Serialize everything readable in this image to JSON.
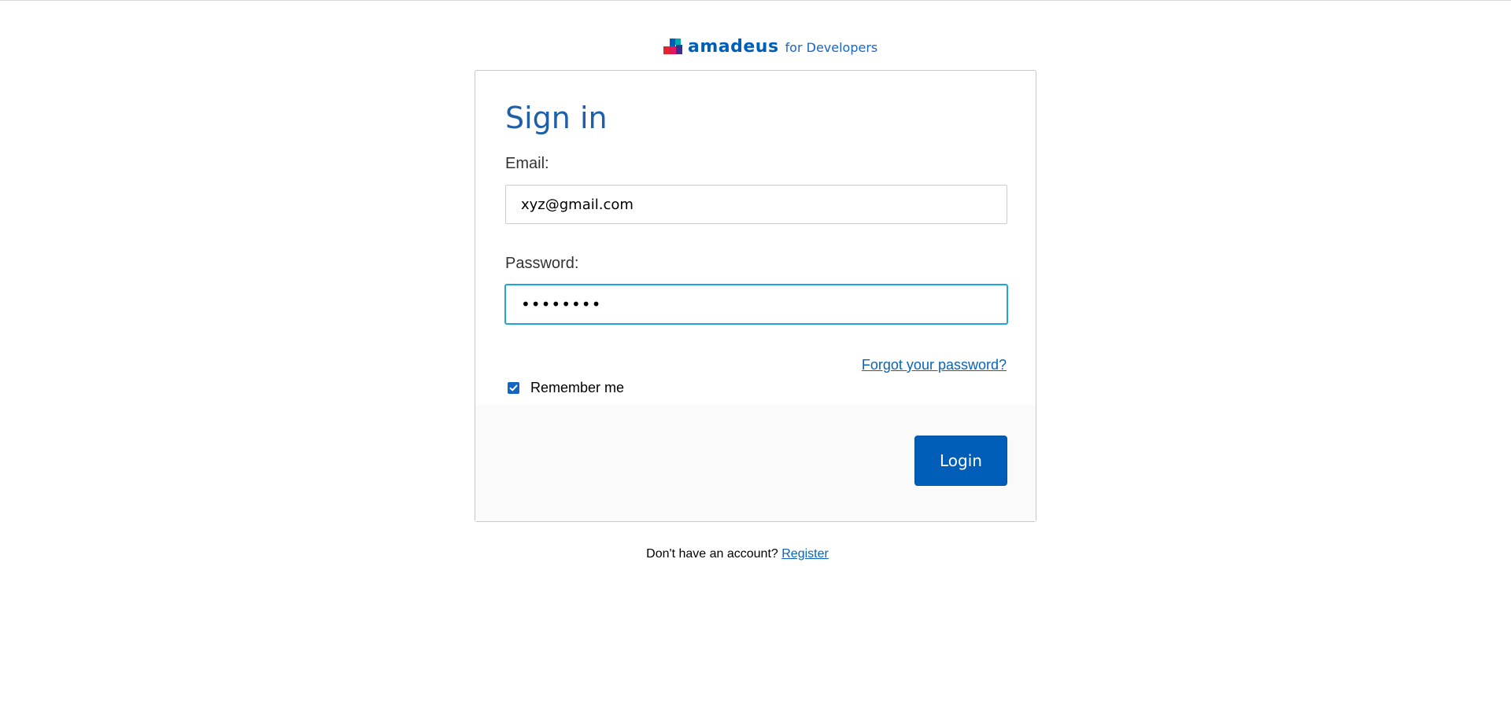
{
  "brand": {
    "name": "amadeus",
    "suffix": "for Developers",
    "color": "#005eb8"
  },
  "form": {
    "title": "Sign in",
    "email_label": "Email:",
    "email_value": "xyz@gmail.com",
    "password_label": "Password:",
    "password_value": "12345678",
    "forgot_link": "Forgot your password?",
    "remember_label": "Remember me",
    "remember_checked": true,
    "login_button": "Login"
  },
  "footer": {
    "prompt": "Don't have an account?",
    "register_link": "Register"
  },
  "icons": {
    "logo": "amadeus-logo-icon",
    "checkbox": "checkmark-icon"
  }
}
